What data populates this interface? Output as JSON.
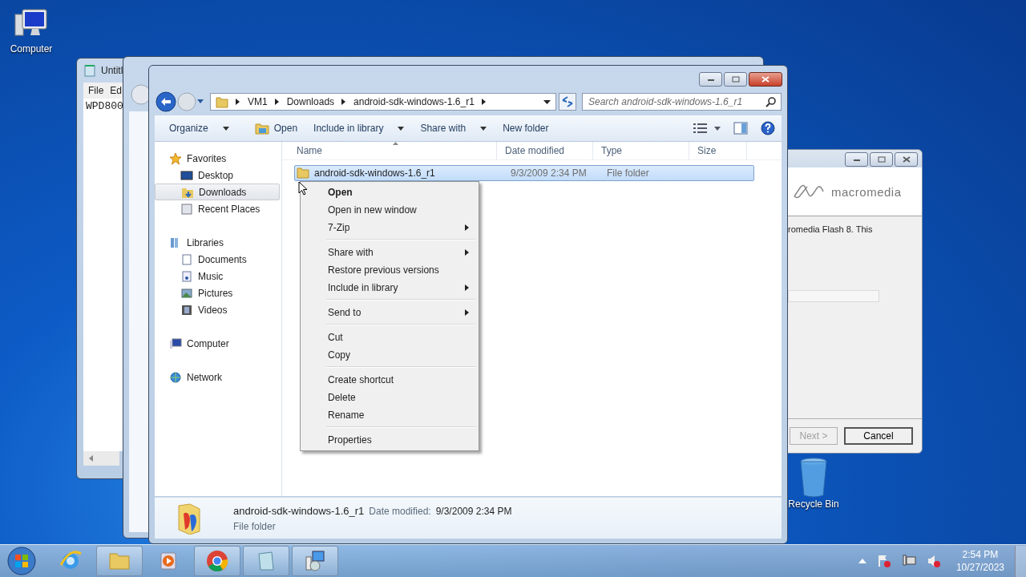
{
  "desktop_icons": [
    {
      "label": "Computer"
    },
    {
      "label": "Recycle Bin"
    }
  ],
  "notepad": {
    "title": "Untitl",
    "menu": [
      "File",
      "Ed"
    ],
    "text": "WPD800"
  },
  "installer": {
    "logo": "macromedia",
    "text": "romedia Flash 8. This",
    "buttons": [
      {
        "label": "Next >",
        "disabled": true
      },
      {
        "label": "Cancel",
        "disabled": false
      }
    ]
  },
  "explorer": {
    "breadcrumb": [
      "VM1",
      "Downloads",
      "android-sdk-windows-1.6_r1"
    ],
    "search": {
      "placeholder": "Search android-sdk-windows-1.6_r1"
    },
    "toolbar": [
      {
        "label": "Organize",
        "dropdown": true
      },
      {
        "label": "Open",
        "dropdown": false
      },
      {
        "label": "Include in library",
        "dropdown": true
      },
      {
        "label": "Share with",
        "dropdown": true
      },
      {
        "label": "New folder",
        "dropdown": false
      }
    ],
    "nav": [
      {
        "label": "Favorites",
        "selected": false,
        "children": [
          {
            "label": "Desktop",
            "selected": false
          },
          {
            "label": "Downloads",
            "selected": true
          },
          {
            "label": "Recent Places",
            "selected": false
          }
        ]
      },
      {
        "label": "Libraries",
        "selected": false,
        "children": [
          {
            "label": "Documents",
            "selected": false
          },
          {
            "label": "Music",
            "selected": false
          },
          {
            "label": "Pictures",
            "selected": false
          },
          {
            "label": "Videos",
            "selected": false
          }
        ]
      },
      {
        "label": "Computer",
        "selected": false
      },
      {
        "label": "Network",
        "selected": false
      }
    ],
    "columns": [
      "Name",
      "Date modified",
      "Type",
      "Size"
    ],
    "rows": [
      {
        "name": "android-sdk-windows-1.6_r1",
        "date": "9/3/2009 2:34 PM",
        "type": "File folder",
        "selected": true
      }
    ],
    "details": {
      "name": "android-sdk-windows-1.6_r1",
      "date_label": "Date modified:",
      "date": "9/3/2009 2:34 PM",
      "type": "File folder"
    }
  },
  "context_menu": [
    [
      {
        "label": "Open",
        "bold": true,
        "submenu": false
      },
      {
        "label": "Open in new window",
        "bold": false,
        "submenu": false
      },
      {
        "label": "7-Zip",
        "bold": false,
        "submenu": true
      }
    ],
    [
      {
        "label": "Share with",
        "bold": false,
        "submenu": true
      },
      {
        "label": "Restore previous versions",
        "bold": false,
        "submenu": false
      },
      {
        "label": "Include in library",
        "bold": false,
        "submenu": true
      }
    ],
    [
      {
        "label": "Send to",
        "bold": false,
        "submenu": true
      }
    ],
    [
      {
        "label": "Cut",
        "bold": false,
        "submenu": false
      },
      {
        "label": "Copy",
        "bold": false,
        "submenu": false
      }
    ],
    [
      {
        "label": "Create shortcut",
        "bold": false,
        "submenu": false
      },
      {
        "label": "Delete",
        "bold": false,
        "submenu": false
      },
      {
        "label": "Rename",
        "bold": false,
        "submenu": false
      }
    ],
    [
      {
        "label": "Properties",
        "bold": false,
        "submenu": false
      }
    ]
  ],
  "taskbar": {
    "apps": [
      {
        "running": false
      },
      {
        "running": true
      },
      {
        "running": false
      },
      {
        "running": true
      },
      {
        "running": true
      },
      {
        "running": true
      }
    ],
    "clock": {
      "time": "2:54 PM",
      "date": "10/27/2023"
    }
  }
}
